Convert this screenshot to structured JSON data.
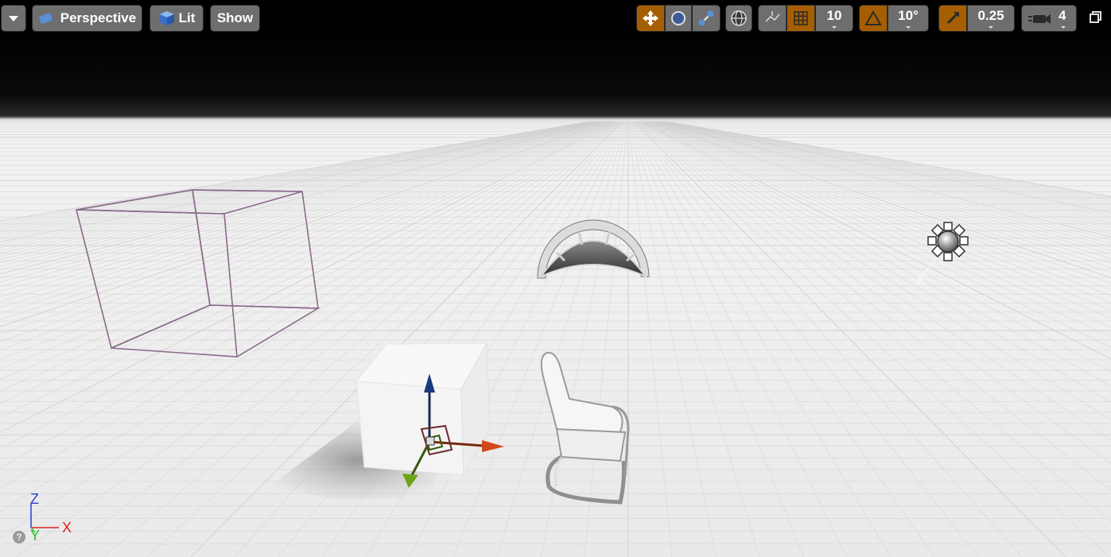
{
  "toolbar": {
    "view_mode": "Perspective",
    "lighting": "Lit",
    "show": "Show",
    "grid_snap": "10",
    "rotation_snap": "10°",
    "scale_snap": "0.25",
    "camera_speed": "4"
  },
  "axes": {
    "z": "Z",
    "x": "X",
    "y": "Y"
  },
  "colors": {
    "accent": "#a65f00",
    "button": "#6e6e6e"
  }
}
